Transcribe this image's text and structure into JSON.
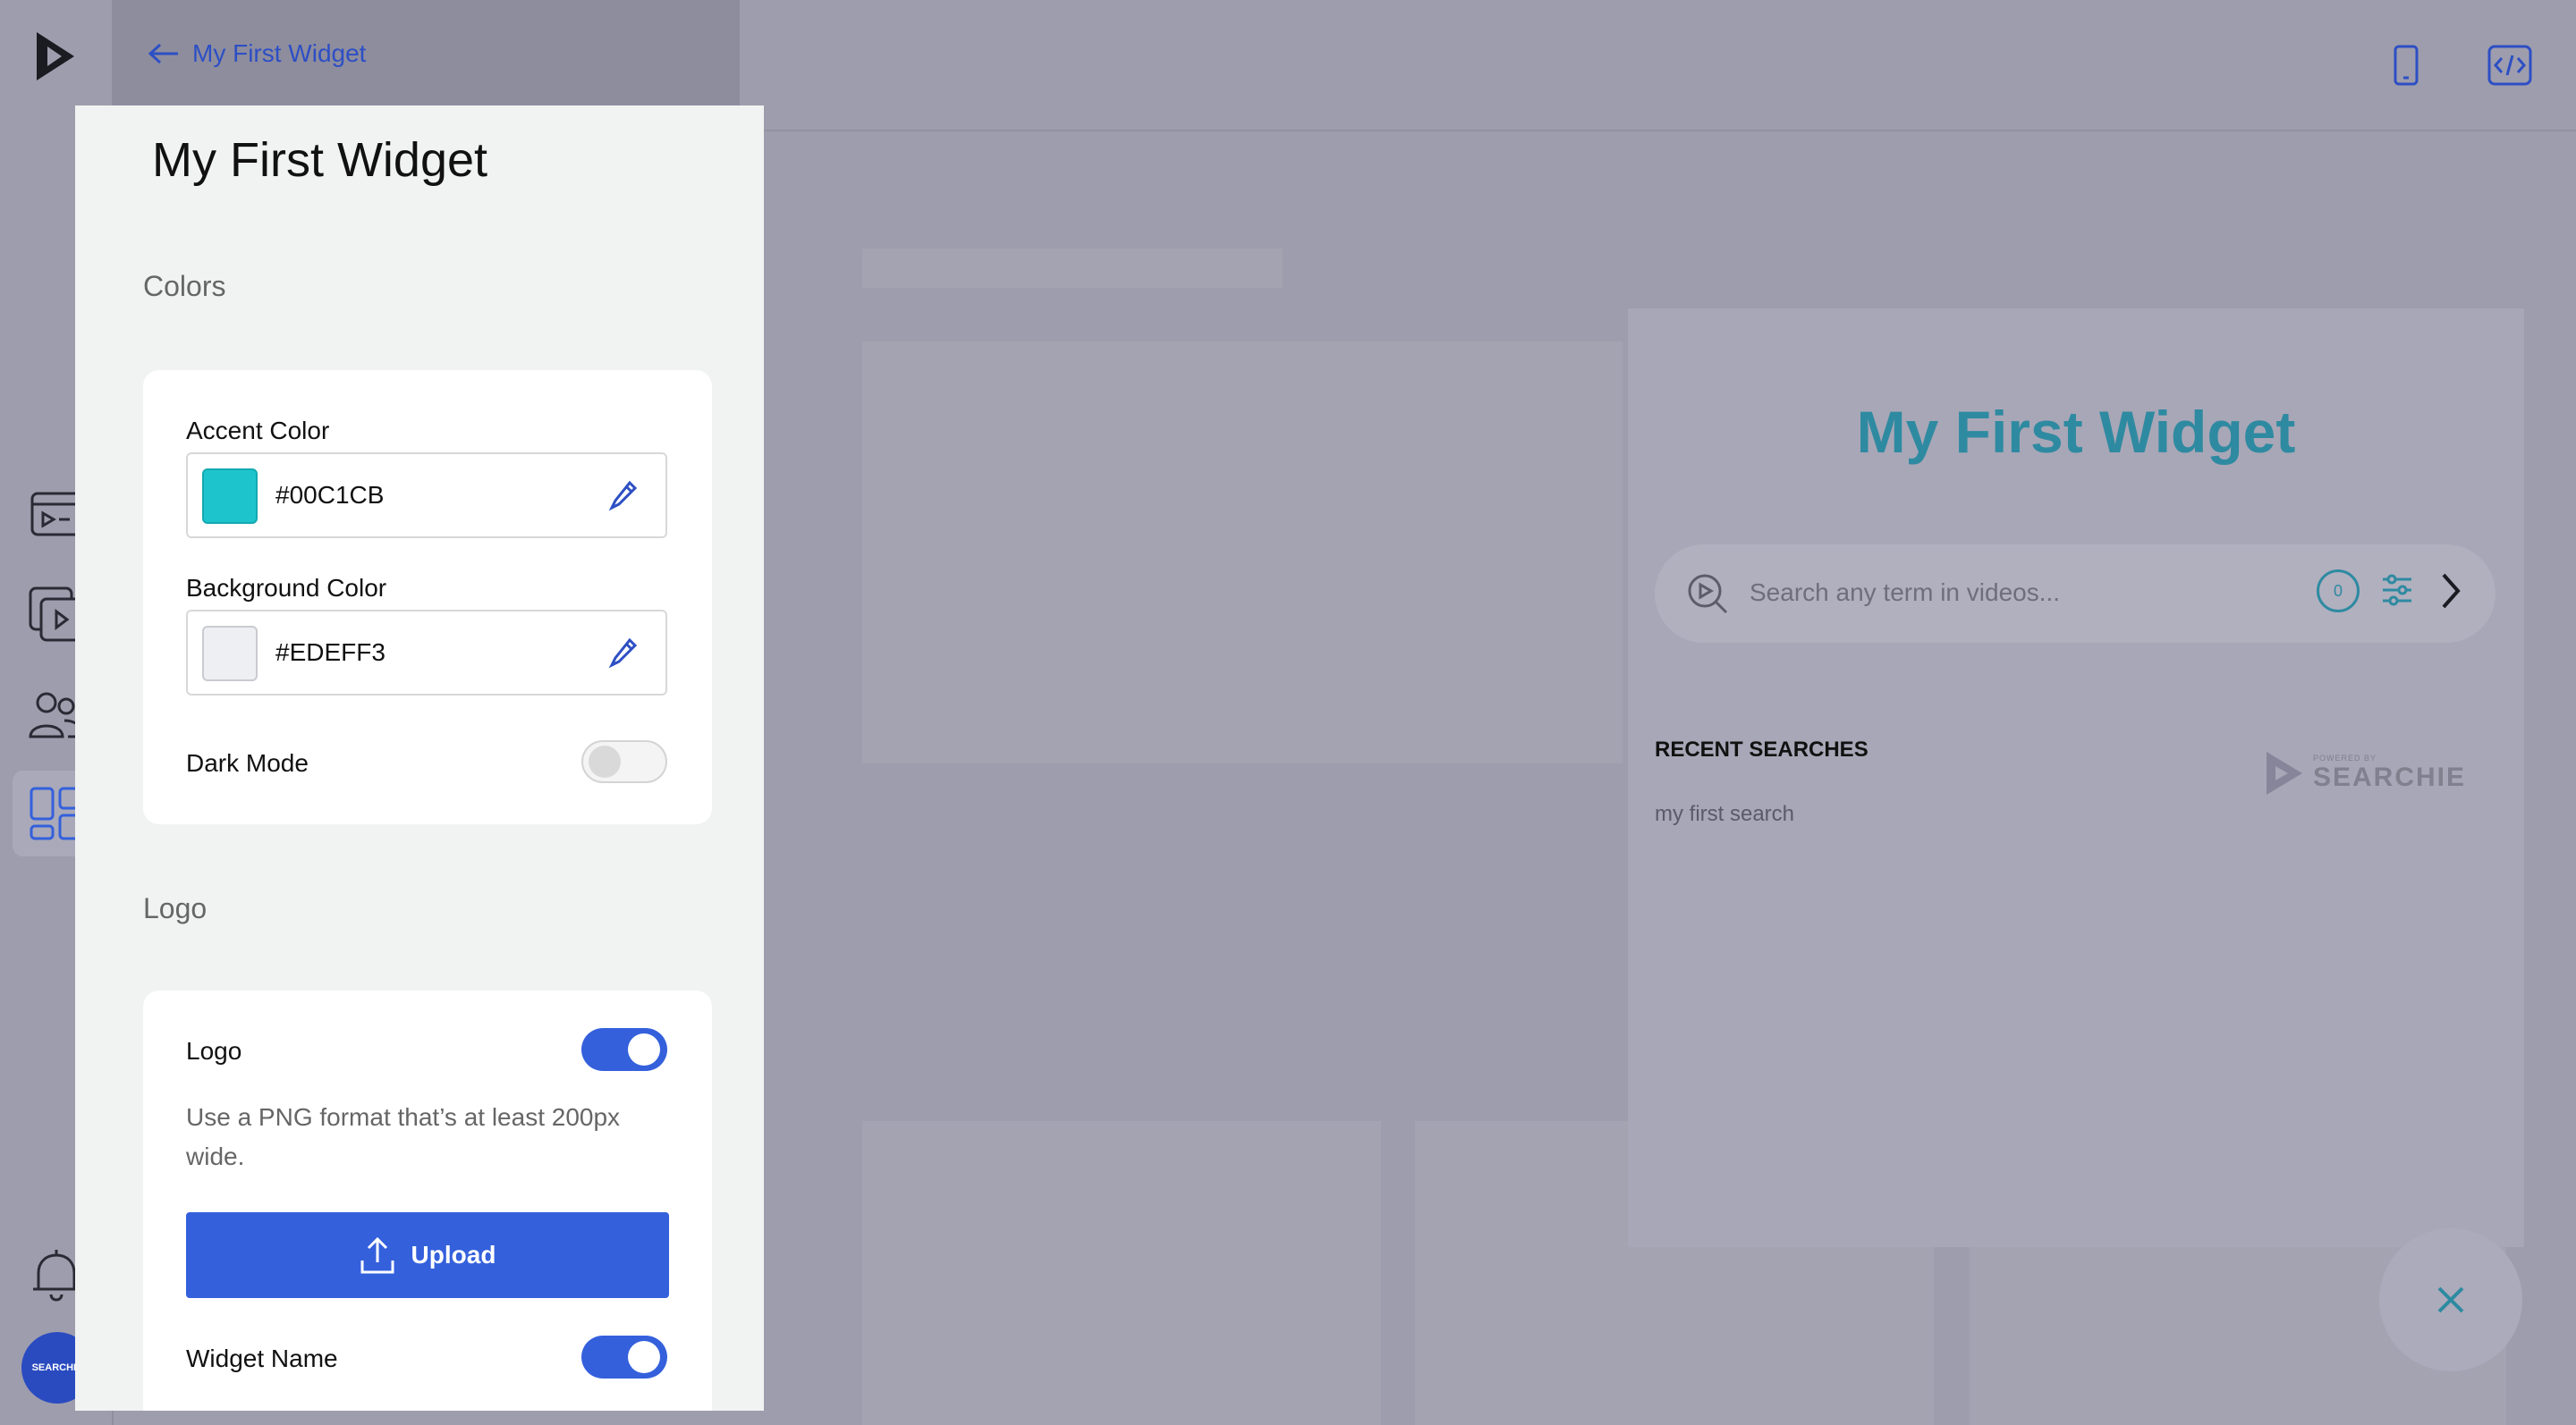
{
  "nav": {
    "back_label": "My First Widget",
    "items": [
      "video-library",
      "playlists",
      "users",
      "widgets"
    ],
    "avatar_text": "SEARCHIE"
  },
  "panel": {
    "title": "My First Widget",
    "colors_section": "Colors",
    "accent_label": "Accent Color",
    "accent_value": "#00C1CB",
    "accent_swatch": "#1ec4cb",
    "background_label": "Background Color",
    "background_value": "#EDEFF3",
    "background_swatch": "#edeff3",
    "dark_mode_label": "Dark Mode",
    "dark_mode_on": false,
    "logo_section": "Logo",
    "logo_label": "Logo",
    "logo_on": true,
    "logo_help": "Use a PNG format that’s at least 200px wide.",
    "upload_label": "Upload",
    "widget_name_label": "Widget Name",
    "widget_name_on": true
  },
  "preview": {
    "title": "My First Widget",
    "search_placeholder": "Search any term in videos...",
    "search_count": "0",
    "recent_heading": "RECENT SEARCHES",
    "recent_items": [
      "my first search"
    ],
    "powered_by": "POWERED BY",
    "brand": "SEARCHIE"
  },
  "colors": {
    "accent": "#3460dc",
    "widget_title": "#2e8aa1"
  }
}
